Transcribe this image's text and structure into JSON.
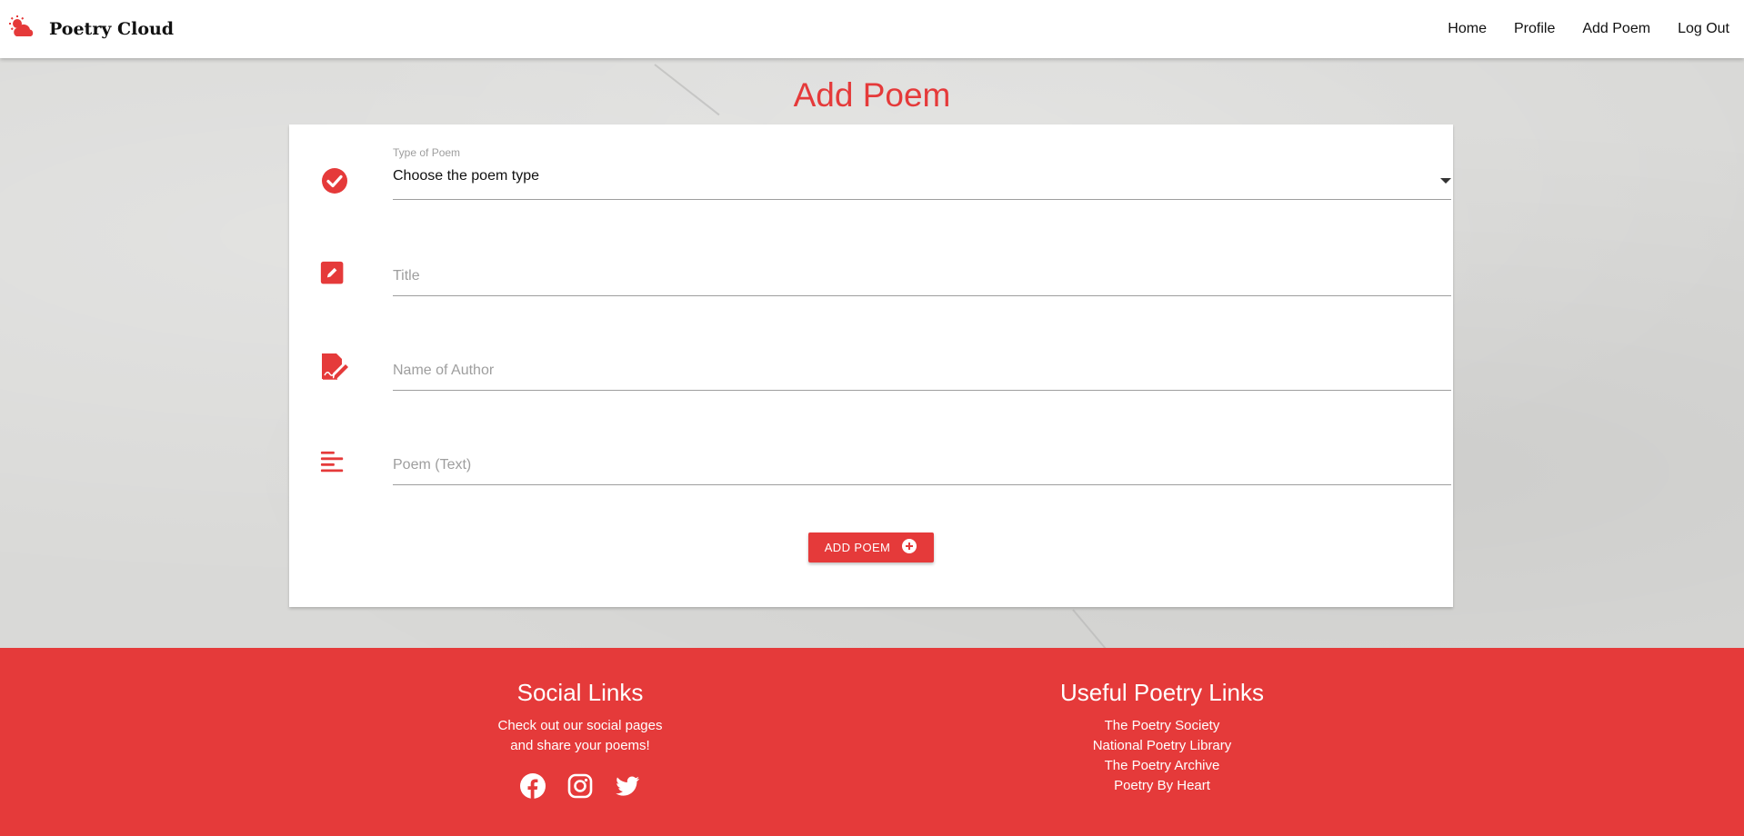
{
  "navbar": {
    "brand": "Poetry Cloud",
    "links": [
      "Home",
      "Profile",
      "Add Poem",
      "Log Out"
    ]
  },
  "page": {
    "title": "Add Poem"
  },
  "form": {
    "type_label": "Type of Poem",
    "type_value": "Choose the poem type",
    "title_placeholder": "Title",
    "author_placeholder": "Name of Author",
    "text_placeholder": "Poem (Text)",
    "submit_label": "ADD POEM"
  },
  "footer": {
    "social_heading": "Social Links",
    "social_text_1": "Check out our social pages",
    "social_text_2": "and share your poems!",
    "social_icons": [
      "facebook-icon",
      "instagram-icon",
      "twitter-icon"
    ],
    "links_heading": "Useful Poetry Links",
    "links": [
      "The Poetry Society",
      "National Poetry Library",
      "The Poetry Archive",
      "Poetry By Heart"
    ]
  },
  "colors": {
    "accent": "#e53a3a"
  }
}
